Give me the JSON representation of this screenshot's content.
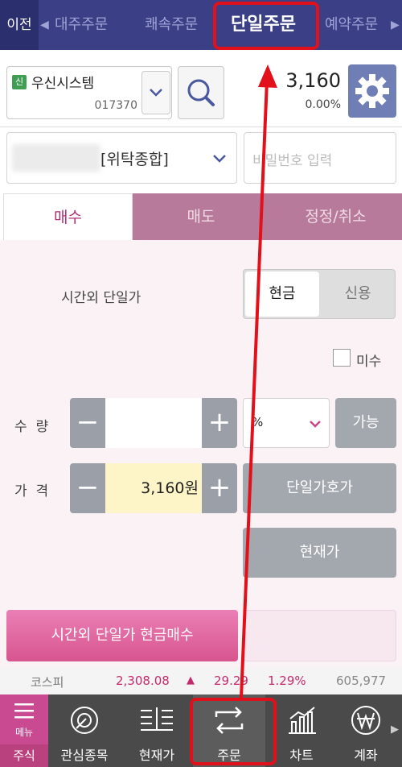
{
  "top_tabs": {
    "prev": "이전",
    "items": [
      "대주주문",
      "쾌속주문",
      "단일주문",
      "예약주문"
    ]
  },
  "stock": {
    "badge": "신",
    "name": "우신시스템",
    "code": "017370",
    "price": "3,160",
    "change_pct": "0.00%"
  },
  "account": {
    "type": "[위탁종합]",
    "password_placeholder": "비밀번호 입력"
  },
  "trade_tabs": [
    "매수",
    "매도",
    "정정/취소"
  ],
  "order": {
    "order_type_label": "시간외 단일가",
    "pay_options": [
      "현금",
      "신용"
    ],
    "misu_label": "미수",
    "qty_label": "수  량",
    "qty_value": "",
    "unit_value": "%",
    "available_label": "가능",
    "price_label": "가  격",
    "price_value": "3,160원",
    "single_price_button": "단일가호가",
    "current_price_button": "현재가",
    "submit_label": "시간외 단일가 현금매수"
  },
  "ticker": {
    "name": "코스피",
    "value": "2,308.08",
    "arrow": "▲",
    "change": "29.29",
    "pct": "1.29%",
    "volume": "605,977"
  },
  "bottom_nav": {
    "menu_top": "메뉴",
    "menu_bottom": "주식",
    "items": [
      "관심종목",
      "현재가",
      "주문",
      "차트",
      "계좌"
    ]
  },
  "colors": {
    "accent": "#b12e70",
    "topbar": "#3b3f86",
    "highlight": "#e2101a"
  }
}
